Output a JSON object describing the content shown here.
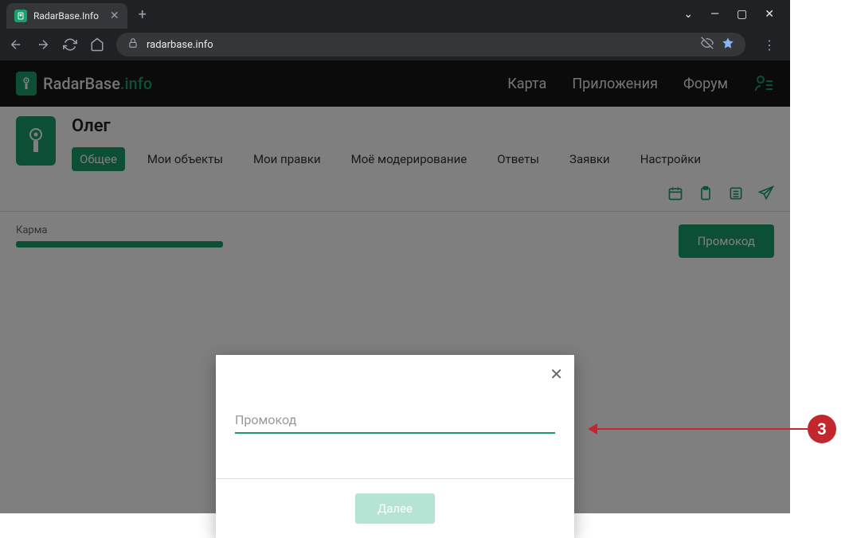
{
  "browser": {
    "tab_title": "RadarBase.Info",
    "url": "radarbase.info"
  },
  "site": {
    "brand_main": "RadarBase",
    "brand_domain": ".info",
    "nav": {
      "map": "Карта",
      "apps": "Приложения",
      "forum": "Форум"
    }
  },
  "profile": {
    "name": "Олег",
    "tabs": {
      "common": "Общее",
      "objects": "Мои объекты",
      "edits": "Мои правки",
      "moderation": "Моё модерирование",
      "answers": "Ответы",
      "requests": "Заявки",
      "settings": "Настройки"
    },
    "karma_label": "Карма",
    "promo_button": "Промокод"
  },
  "modal": {
    "input_placeholder": "Промокод",
    "next_button": "Далее"
  },
  "annotation": {
    "number": "3"
  },
  "colors": {
    "accent": "#1a9e6b",
    "annotation": "#c1272d"
  }
}
